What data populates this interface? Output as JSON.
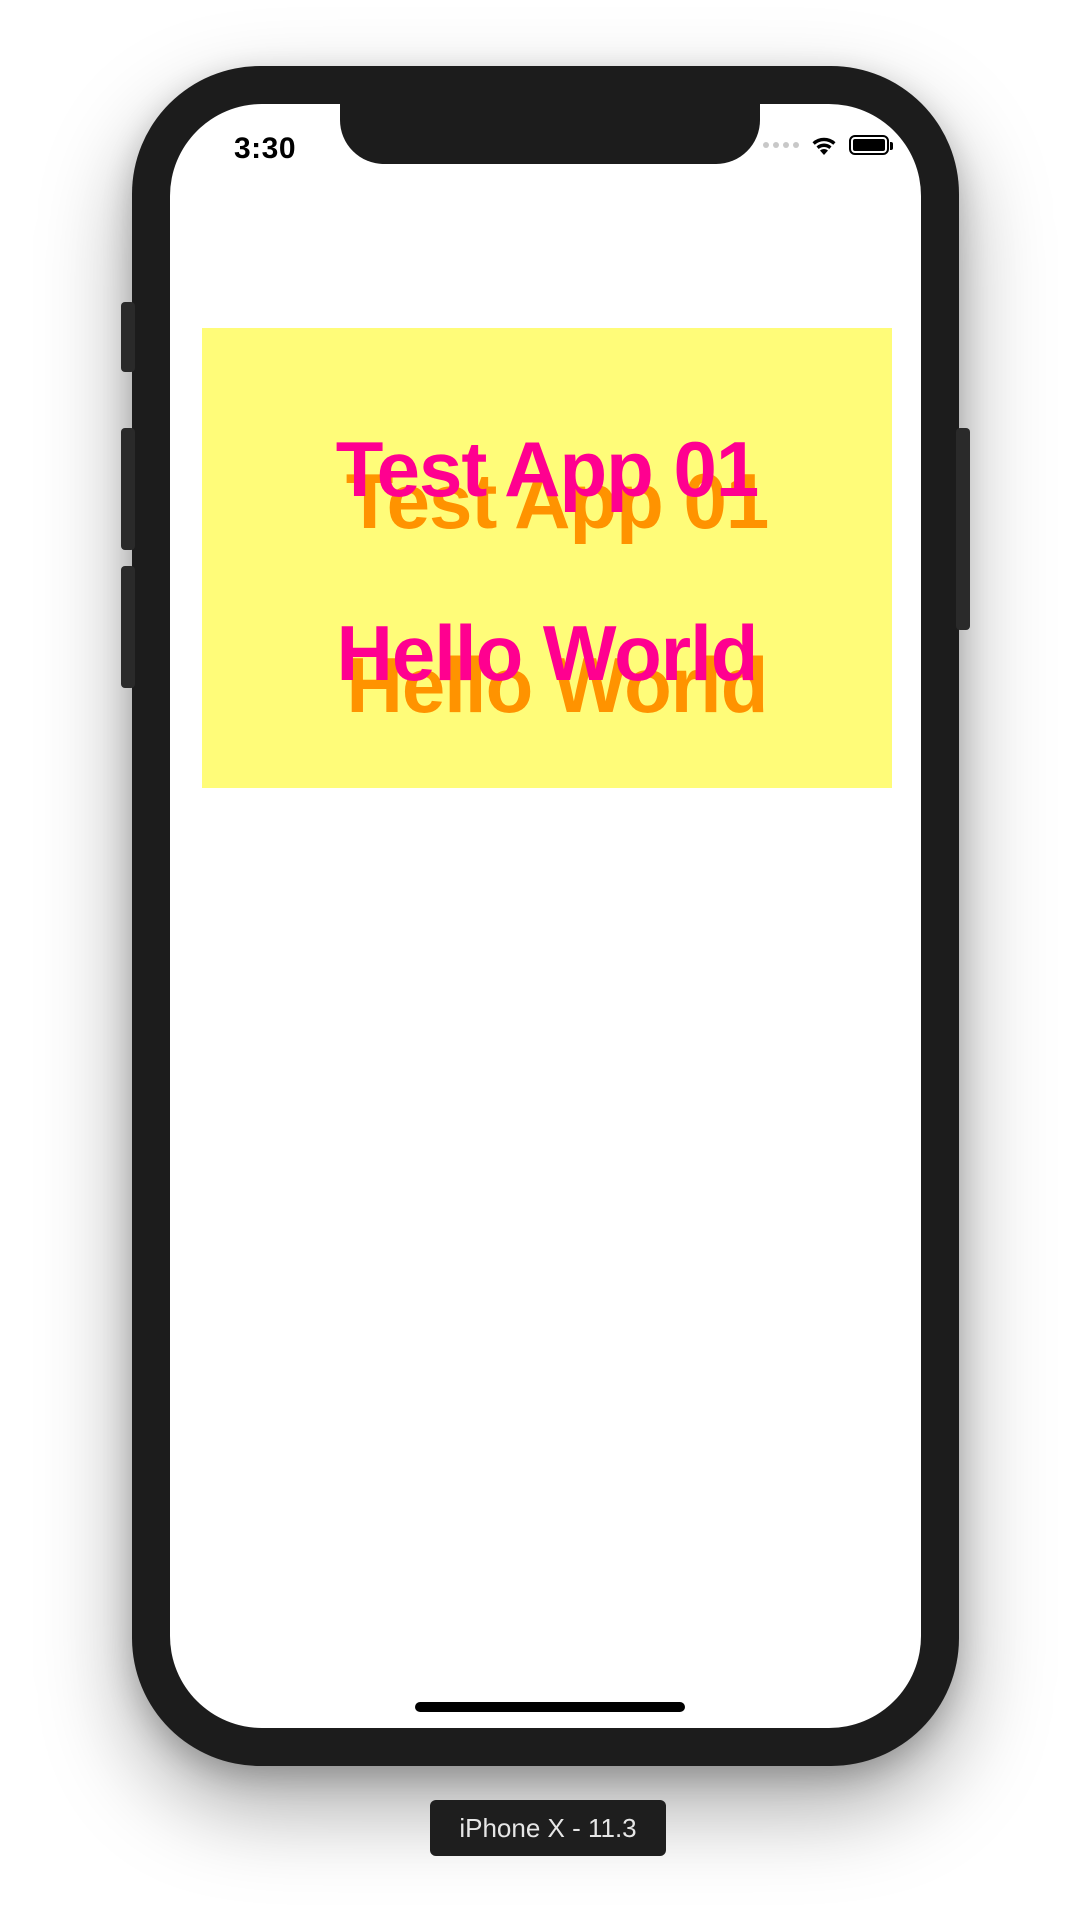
{
  "status_bar": {
    "time": "3:30"
  },
  "app": {
    "title_label": "Test App 01",
    "subtitle_label": "Hello World",
    "colors": {
      "box_background": "#fffc79",
      "text_front": "#ff0090",
      "text_shadow": "#ff9300"
    }
  },
  "icons": {
    "signal": "signal-dots-icon",
    "wifi": "wifi-icon",
    "battery": "battery-icon"
  },
  "simulator": {
    "device_label": "iPhone X - 11.3"
  }
}
